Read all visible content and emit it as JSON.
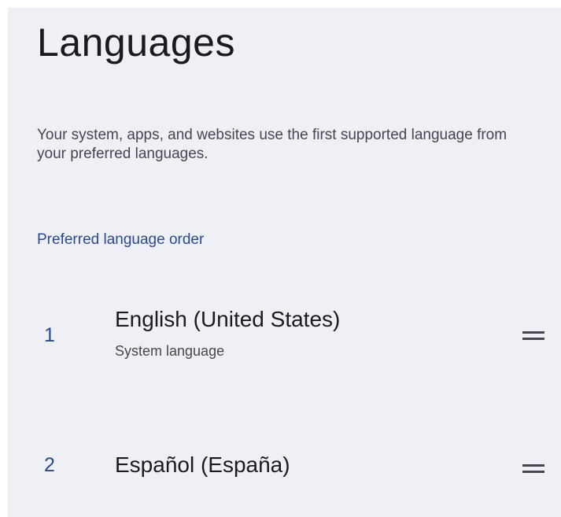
{
  "page": {
    "title": "Languages",
    "description": "Your system, apps, and websites use the first supported language from your preferred languages.",
    "section_header": "Preferred language order"
  },
  "languages": [
    {
      "index": "1",
      "name": "English (United States)",
      "subtitle": "System language",
      "handle_icon": "drag-handle-icon"
    },
    {
      "index": "2",
      "name": "Español (España)",
      "handle_icon": "drag-handle-icon"
    }
  ],
  "colors": {
    "background": "#eef0f5",
    "accent": "#2b4a8b",
    "text_primary": "#1b1b1f",
    "text_secondary": "#45464f"
  }
}
